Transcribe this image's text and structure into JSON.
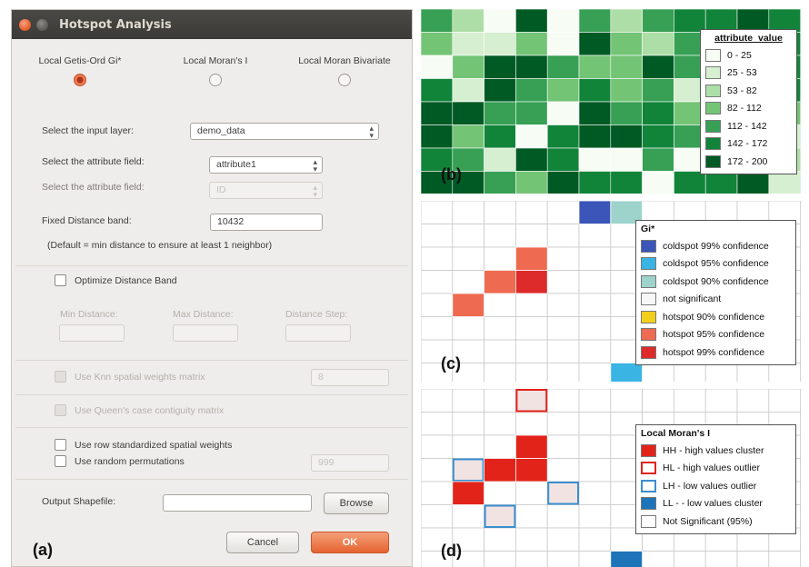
{
  "dialog": {
    "title": "Hotspot Analysis",
    "methods": [
      {
        "label": "Local Getis-Ord Gi*",
        "selected": true
      },
      {
        "label": "Local Moran's I",
        "selected": false
      },
      {
        "label": "Local Moran Bivariate",
        "selected": false
      }
    ],
    "input_layer_label": "Select the input layer:",
    "input_layer_value": "demo_data",
    "attribute_field_label": "Select the attribute field:",
    "attribute_field_value": "attribute1",
    "attribute_field2_label": "Select the attribute field:",
    "attribute_field2_value": "ID",
    "fixed_distance_label": "Fixed Distance band:",
    "fixed_distance_value": "10432",
    "fixed_distance_note": "(Default = min distance to ensure at least 1 neighbor)",
    "optimize_label": "Optimize Distance Band",
    "min_distance_label": "Min Distance:",
    "max_distance_label": "Max Distance:",
    "distance_step_label": "Distance Step:",
    "knn_label": "Use Knn spatial weights matrix",
    "knn_value": "8",
    "queen_label": "Use Queen's case contiguity matrix",
    "row_std_label": "Use row standardized spatial weights",
    "random_perm_label": "Use random permutations",
    "random_perm_value": "999",
    "output_label": "Output Shapefile:",
    "browse_label": "Browse",
    "cancel_label": "Cancel",
    "ok_label": "OK",
    "panel_letter": "(a)"
  },
  "panel_b": {
    "letter": "(b)",
    "legend_title": "attribute_value",
    "classes": [
      {
        "label": "0 - 25",
        "color": "#f7fcf5"
      },
      {
        "label": "25 - 53",
        "color": "#d6efd0"
      },
      {
        "label": "53 - 82",
        "color": "#aedea7"
      },
      {
        "label": "82 - 112",
        "color": "#74c476"
      },
      {
        "label": "112 - 142",
        "color": "#37a055"
      },
      {
        "label": "142 - 172",
        "color": "#11843a"
      },
      {
        "label": "172 - 200",
        "color": "#005a24"
      }
    ],
    "grid": [
      [
        4,
        2,
        0,
        6,
        0,
        4,
        2,
        4,
        5,
        5,
        6,
        5
      ],
      [
        3,
        1,
        1,
        3,
        0,
        6,
        3,
        2,
        4,
        5,
        4,
        5
      ],
      [
        0,
        3,
        6,
        6,
        4,
        3,
        3,
        6,
        4,
        0,
        0,
        5
      ],
      [
        5,
        1,
        6,
        4,
        3,
        5,
        3,
        4,
        1,
        5,
        5,
        5
      ],
      [
        6,
        6,
        4,
        4,
        0,
        6,
        4,
        5,
        3,
        3,
        4,
        3
      ],
      [
        6,
        3,
        5,
        0,
        5,
        6,
        6,
        5,
        4,
        3,
        0,
        1
      ],
      [
        5,
        4,
        1,
        6,
        5,
        0,
        0,
        4,
        0,
        0,
        3,
        2
      ],
      [
        6,
        6,
        4,
        3,
        6,
        5,
        5,
        0,
        5,
        5,
        6,
        1
      ]
    ]
  },
  "panel_c": {
    "letter": "(c)",
    "legend_title": "Gi*",
    "classes": [
      {
        "label": "coldspot 99% confidence",
        "color": "#3b55b8"
      },
      {
        "label": "coldspot 95% confidence",
        "color": "#39b4e3"
      },
      {
        "label": "coldspot 90% confidence",
        "color": "#9ed3cc"
      },
      {
        "label": "not significant",
        "color": "#f7f7f7"
      },
      {
        "label": "hotspot 90% confidence",
        "color": "#f2cf1b"
      },
      {
        "label": "hotspot 95% confidence",
        "color": "#ee6a50"
      },
      {
        "label": "hotspot 99% confidence",
        "color": "#dd2a2a"
      }
    ],
    "cells": [
      {
        "row": 0,
        "col": 5,
        "cls": 0
      },
      {
        "row": 0,
        "col": 6,
        "cls": 2
      },
      {
        "row": 2,
        "col": 3,
        "cls": 5
      },
      {
        "row": 3,
        "col": 2,
        "cls": 5
      },
      {
        "row": 3,
        "col": 3,
        "cls": 6
      },
      {
        "row": 4,
        "col": 1,
        "cls": 5
      },
      {
        "row": 7,
        "col": 6,
        "cls": 1
      }
    ]
  },
  "panel_d": {
    "letter": "(d)",
    "legend_title": "Local Moran's I",
    "classes": [
      {
        "label": "HH - high values cluster",
        "color": "#e2231a",
        "style": "fill"
      },
      {
        "label": "HL - high values outlier",
        "color": "#e2231a",
        "style": "outline"
      },
      {
        "label": "LH - low values outlier",
        "color": "#3a8fd0",
        "style": "outline"
      },
      {
        "label": "LL - - low values cluster",
        "color": "#1d74b8",
        "style": "fill"
      },
      {
        "label": "Not Significant (95%)",
        "color": "#ffffff",
        "style": "fill"
      }
    ],
    "cells": [
      {
        "row": 0,
        "col": 3,
        "cls": 1
      },
      {
        "row": 2,
        "col": 3,
        "cls": 0
      },
      {
        "row": 3,
        "col": 1,
        "cls": 2
      },
      {
        "row": 3,
        "col": 2,
        "cls": 0
      },
      {
        "row": 3,
        "col": 3,
        "cls": 0
      },
      {
        "row": 4,
        "col": 1,
        "cls": 0
      },
      {
        "row": 4,
        "col": 4,
        "cls": 2
      },
      {
        "row": 5,
        "col": 2,
        "cls": 2
      },
      {
        "row": 7,
        "col": 6,
        "cls": 3
      }
    ]
  }
}
